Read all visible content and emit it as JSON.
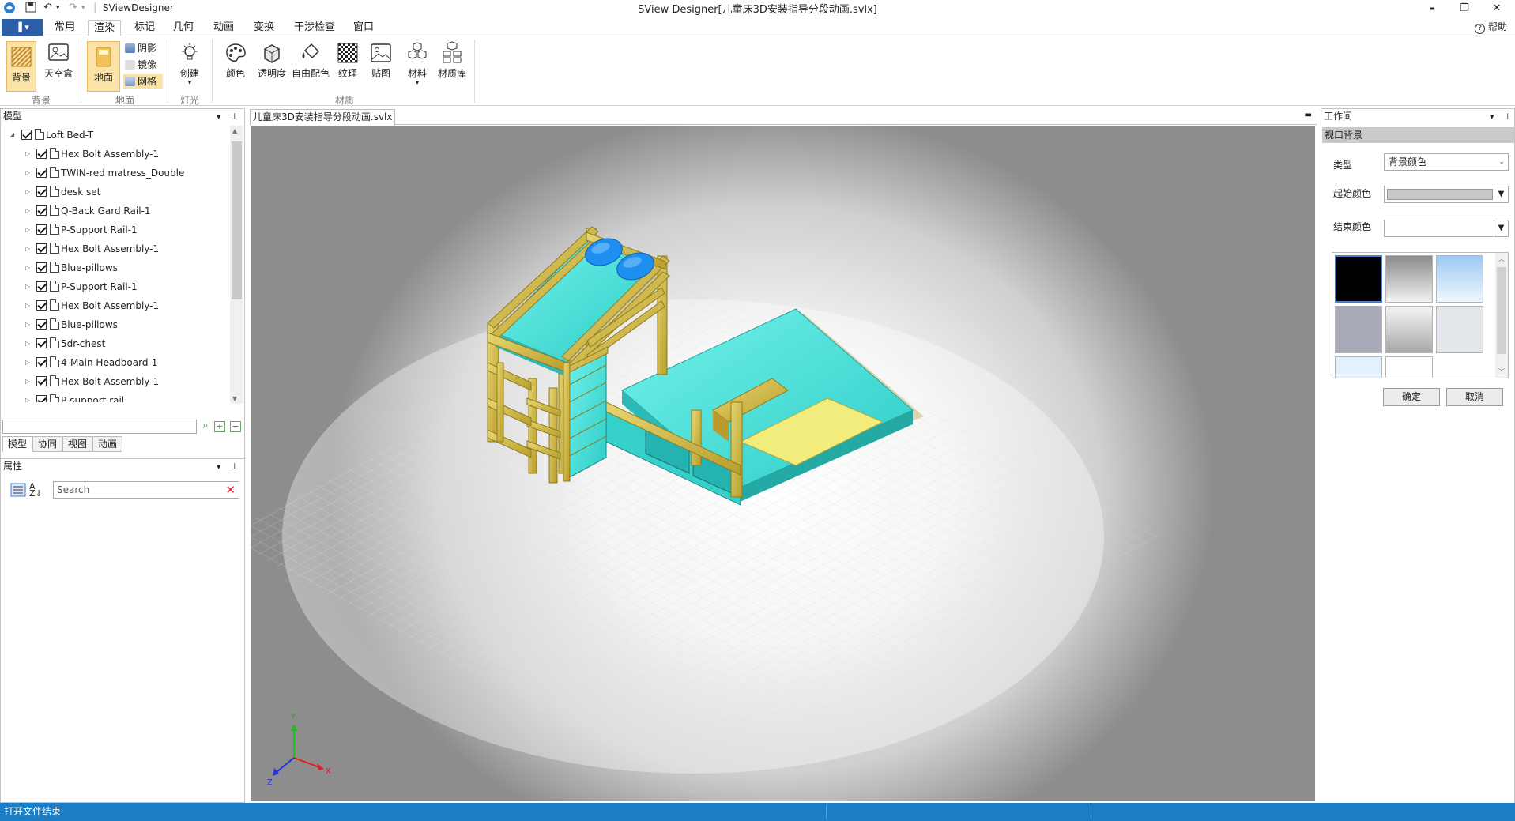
{
  "window": {
    "app_name": "SViewDesigner",
    "title": "SView Designer[儿童床3D安装指导分段动画.svlx]",
    "minimize_symbol": "▬",
    "restore_symbol": "❐",
    "close_symbol": "✕"
  },
  "menu": {
    "file_label": "▐ ▾",
    "tabs": [
      "常用",
      "渲染",
      "标记",
      "几何",
      "动画",
      "变换",
      "干涉检查",
      "窗口"
    ],
    "active_tab": "渲染",
    "help": "帮助"
  },
  "ribbon": {
    "groups": {
      "background": "背景",
      "ground": "地面",
      "light": "灯光",
      "material": "材质"
    },
    "buttons": {
      "background": "背景",
      "skybox": "天空盒",
      "ground": "地面",
      "shadow": "阴影",
      "mirror": "镜像",
      "grid": "网格",
      "create": "创建",
      "color": "颜色",
      "transparency": "透明度",
      "free_color": "自由配色",
      "texture": "纹理",
      "decal": "贴图",
      "material": "材料",
      "material_library": "材质库"
    }
  },
  "model_panel": {
    "title": "模型",
    "root": "Loft Bed-T",
    "items": [
      "Hex Bolt Assembly-1",
      "TWIN-red matress_Double",
      "desk set",
      "Q-Back Gard Rail-1",
      "P-Support Rail-1",
      "Hex Bolt Assembly-1",
      "Blue-pillows",
      "P-Support Rail-1",
      "Hex Bolt Assembly-1",
      "Blue-pillows",
      "5dr-chest",
      "4-Main Headboard-1",
      "Hex Bolt Assembly-1",
      "P-support rail"
    ],
    "tabs": [
      "模型",
      "协同",
      "视图",
      "动画"
    ],
    "active_tab": "模型"
  },
  "props_panel": {
    "title": "属性",
    "search_placeholder": "Search"
  },
  "document": {
    "tab": "儿童床3D安装指导分段动画.svlx"
  },
  "axes": {
    "x": "X",
    "y": "Y",
    "z": "Z"
  },
  "work_panel": {
    "title": "工作间",
    "section": "视口背景",
    "type_label": "类型",
    "type_value": "背景颜色",
    "start_color_label": "起始颜色",
    "end_color_label": "结束颜色",
    "ok": "确定",
    "cancel": "取消",
    "swatch_names": [
      "black",
      "gray-gradient",
      "sky-blue-gradient",
      "slate-gray",
      "silver-gradient",
      "light-gray",
      "pale-blue",
      "white"
    ]
  },
  "status": {
    "message": "打开文件结束"
  },
  "colors": {
    "accent": "#1b7ec5",
    "ribbon_selected": "#fbe2a7",
    "wood": "#d9c356",
    "mattress": "#4fe5e0",
    "pillow": "#1e8ef0"
  }
}
